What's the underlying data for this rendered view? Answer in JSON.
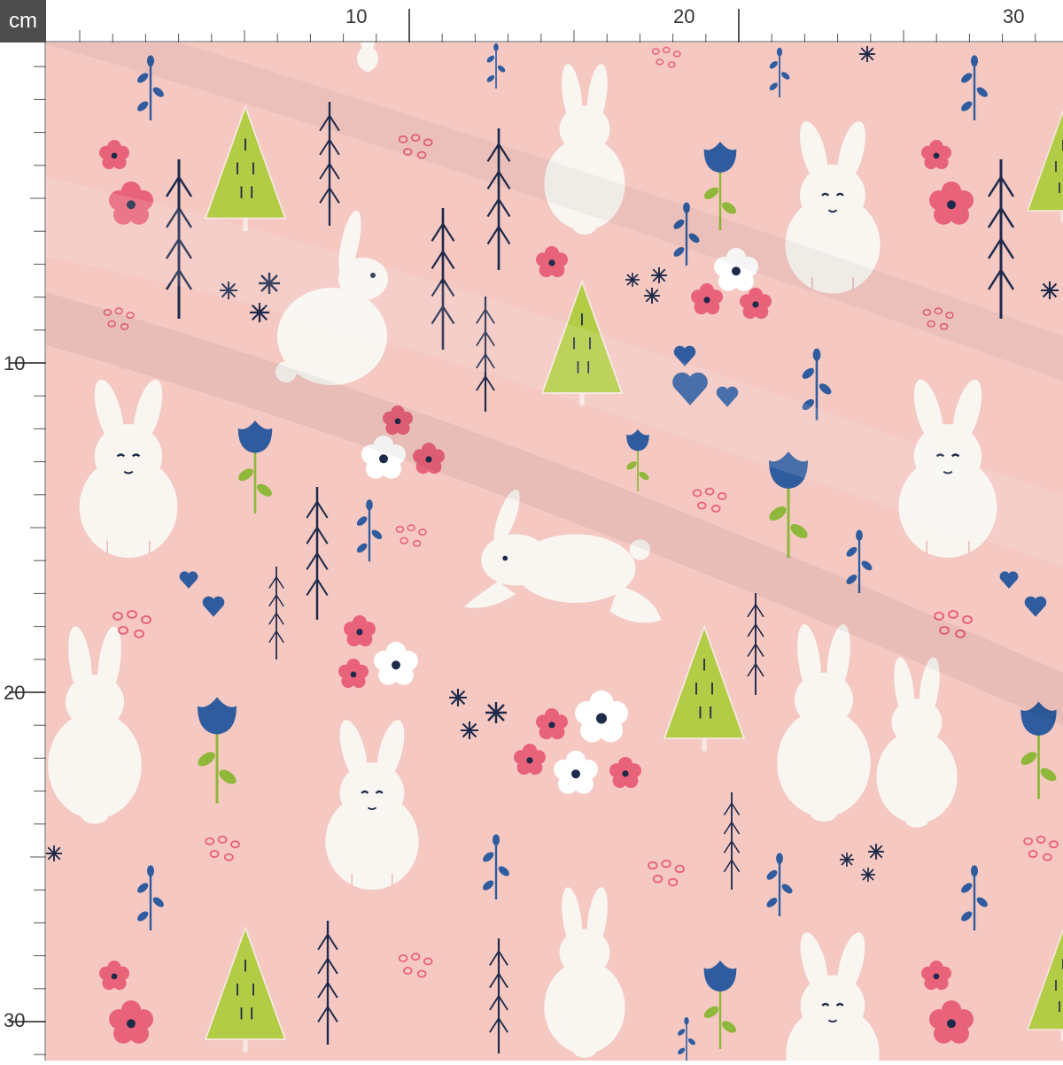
{
  "ruler": {
    "unit": "cm",
    "top_labels": [
      "10",
      "20",
      "30"
    ],
    "left_labels": [
      "10",
      "20",
      "30"
    ]
  },
  "colors": {
    "background": "#f5c8c2",
    "rabbit": "#f9f6f2",
    "tree": "#b3cc45",
    "navy": "#1e2a4a",
    "blue": "#2f5c9e",
    "pink": "#e8637a",
    "leaf": "#8fb83a"
  },
  "motifs": [
    "rabbit",
    "tree",
    "flower",
    "stem",
    "heart",
    "snowflake",
    "dots"
  ]
}
